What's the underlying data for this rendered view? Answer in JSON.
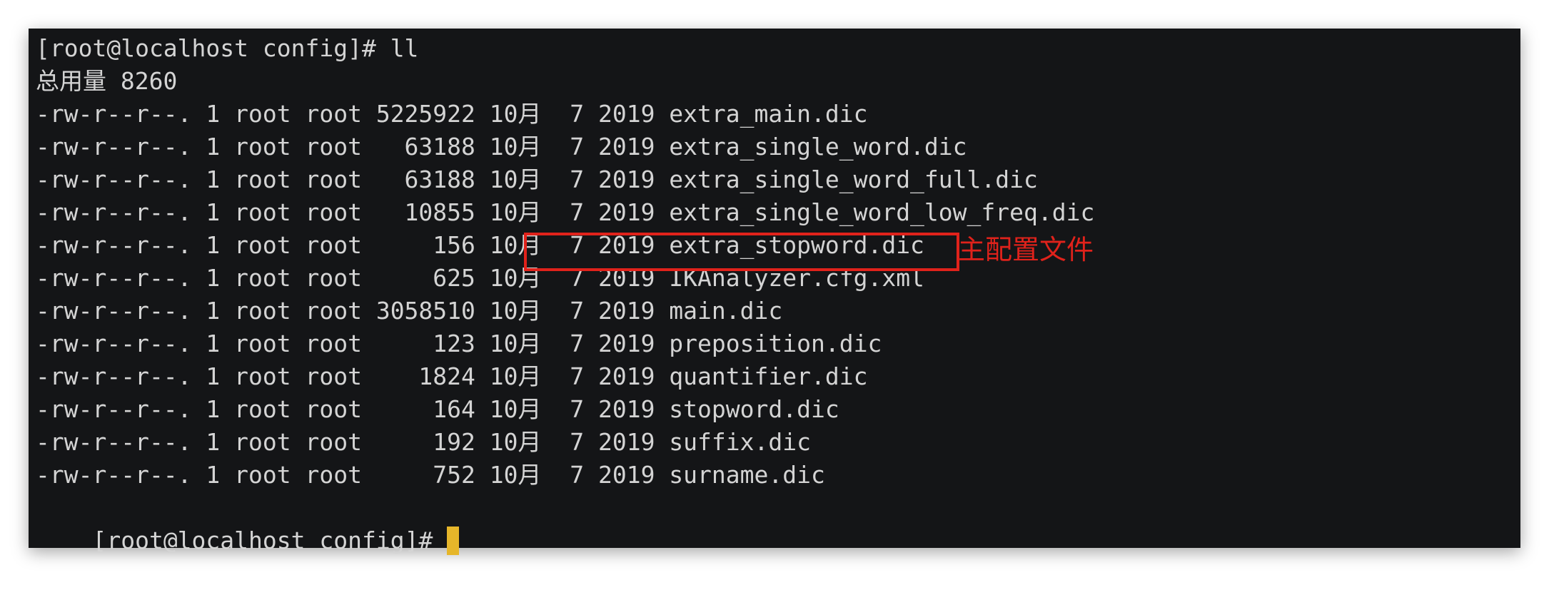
{
  "terminal": {
    "lines": [
      "[root@localhost config]# ll",
      "总用量 8260",
      "-rw-r--r--. 1 root root 5225922 10月  7 2019 extra_main.dic",
      "-rw-r--r--. 1 root root   63188 10月  7 2019 extra_single_word.dic",
      "-rw-r--r--. 1 root root   63188 10月  7 2019 extra_single_word_full.dic",
      "-rw-r--r--. 1 root root   10855 10月  7 2019 extra_single_word_low_freq.dic",
      "-rw-r--r--. 1 root root     156 10月  7 2019 extra_stopword.dic",
      "-rw-r--r--. 1 root root     625 10月  7 2019 IKAnalyzer.cfg.xml",
      "-rw-r--r--. 1 root root 3058510 10月  7 2019 main.dic",
      "-rw-r--r--. 1 root root     123 10月  7 2019 preposition.dic",
      "-rw-r--r--. 1 root root    1824 10月  7 2019 quantifier.dic",
      "-rw-r--r--. 1 root root     164 10月  7 2019 stopword.dic",
      "-rw-r--r--. 1 root root     192 10月  7 2019 suffix.dic",
      "-rw-r--r--. 1 root root     752 10月  7 2019 surname.dic"
    ],
    "prompt": "[root@localhost config]# "
  },
  "annotation": {
    "text": "主配置文件",
    "color": "#e0221b"
  },
  "colors": {
    "background": "#141517",
    "text": "#d4d4d4",
    "cursor": "#e6b62a"
  }
}
